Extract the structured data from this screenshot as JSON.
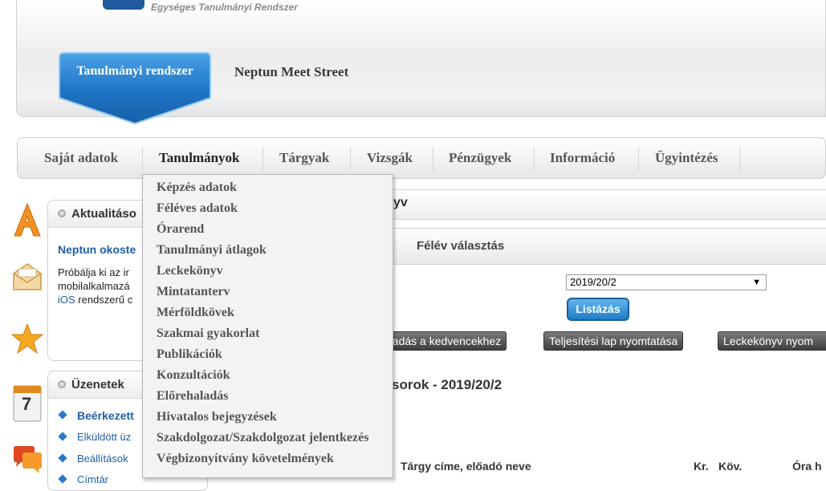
{
  "header": {
    "subtitle": "Egységes Tanulmányi Rendszer",
    "tab_active": "Tanulmányi rendszer",
    "tab_other": "Neptun Meet Street"
  },
  "mainnav": {
    "items": [
      "Saját adatok",
      "Tanulmányok",
      "Tárgyak",
      "Vizsgák",
      "Pénzügyek",
      "Információ",
      "Ügyintézés"
    ],
    "active": "Tanulmányok"
  },
  "dropdown": {
    "items": [
      "Képzés adatok",
      "Féléves adatok",
      "Órarend",
      "Tanulmányi átlagok",
      "Leckekönyv",
      "Mintatanterv",
      "Mérföldkövek",
      "Szakmai gyakorlat",
      "Publikációk",
      "Konzultációk",
      "Előrehaladás",
      "Hivatalos bejegyzések",
      "Szakdolgozat/Szakdolgozat jelentkezés",
      "Végbizonyítvány követelmények"
    ]
  },
  "sidebar": {
    "aktualitasok": {
      "title": "Aktualitáso",
      "headline": "Neptun okoste",
      "line1": "Próbálja ki az ir",
      "line2": "mobilalkalmazá",
      "line3_link": "iOS",
      "line3_rest": " rendszerű c"
    },
    "uzenetek": {
      "title": "Üzenetek",
      "items": [
        "Beérkezett",
        "Elküldött üz",
        "Beállítások",
        "Címtár"
      ]
    },
    "calendar_day": "7"
  },
  "content": {
    "title_fragment": "yv",
    "felev_label": "Félév választás",
    "select_value": "2019/20/2",
    "list_button": "Listázás",
    "actions": [
      "áadás a kedvencekhez",
      "Teljesítési lap nyomtatása",
      "Leckekönyv nyom"
    ],
    "section_title": "sorok - 2019/20/2",
    "columns": [
      "Tárgy címe, előadó neve",
      "Kr.",
      "Köv.",
      "Óra h"
    ]
  },
  "colors": {
    "accent_blue": "#1f7ec8",
    "tab_blue": "#2a84d2",
    "link_blue": "#1f5fa6"
  }
}
